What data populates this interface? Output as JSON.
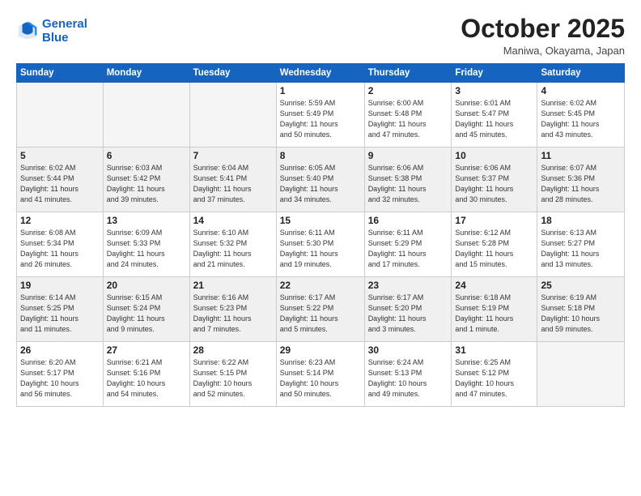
{
  "logo": {
    "line1": "General",
    "line2": "Blue"
  },
  "title": "October 2025",
  "location": "Maniwa, Okayama, Japan",
  "weekdays": [
    "Sunday",
    "Monday",
    "Tuesday",
    "Wednesday",
    "Thursday",
    "Friday",
    "Saturday"
  ],
  "weeks": [
    [
      {
        "day": "",
        "info": ""
      },
      {
        "day": "",
        "info": ""
      },
      {
        "day": "",
        "info": ""
      },
      {
        "day": "1",
        "info": "Sunrise: 5:59 AM\nSunset: 5:49 PM\nDaylight: 11 hours\nand 50 minutes."
      },
      {
        "day": "2",
        "info": "Sunrise: 6:00 AM\nSunset: 5:48 PM\nDaylight: 11 hours\nand 47 minutes."
      },
      {
        "day": "3",
        "info": "Sunrise: 6:01 AM\nSunset: 5:47 PM\nDaylight: 11 hours\nand 45 minutes."
      },
      {
        "day": "4",
        "info": "Sunrise: 6:02 AM\nSunset: 5:45 PM\nDaylight: 11 hours\nand 43 minutes."
      }
    ],
    [
      {
        "day": "5",
        "info": "Sunrise: 6:02 AM\nSunset: 5:44 PM\nDaylight: 11 hours\nand 41 minutes."
      },
      {
        "day": "6",
        "info": "Sunrise: 6:03 AM\nSunset: 5:42 PM\nDaylight: 11 hours\nand 39 minutes."
      },
      {
        "day": "7",
        "info": "Sunrise: 6:04 AM\nSunset: 5:41 PM\nDaylight: 11 hours\nand 37 minutes."
      },
      {
        "day": "8",
        "info": "Sunrise: 6:05 AM\nSunset: 5:40 PM\nDaylight: 11 hours\nand 34 minutes."
      },
      {
        "day": "9",
        "info": "Sunrise: 6:06 AM\nSunset: 5:38 PM\nDaylight: 11 hours\nand 32 minutes."
      },
      {
        "day": "10",
        "info": "Sunrise: 6:06 AM\nSunset: 5:37 PM\nDaylight: 11 hours\nand 30 minutes."
      },
      {
        "day": "11",
        "info": "Sunrise: 6:07 AM\nSunset: 5:36 PM\nDaylight: 11 hours\nand 28 minutes."
      }
    ],
    [
      {
        "day": "12",
        "info": "Sunrise: 6:08 AM\nSunset: 5:34 PM\nDaylight: 11 hours\nand 26 minutes."
      },
      {
        "day": "13",
        "info": "Sunrise: 6:09 AM\nSunset: 5:33 PM\nDaylight: 11 hours\nand 24 minutes."
      },
      {
        "day": "14",
        "info": "Sunrise: 6:10 AM\nSunset: 5:32 PM\nDaylight: 11 hours\nand 21 minutes."
      },
      {
        "day": "15",
        "info": "Sunrise: 6:11 AM\nSunset: 5:30 PM\nDaylight: 11 hours\nand 19 minutes."
      },
      {
        "day": "16",
        "info": "Sunrise: 6:11 AM\nSunset: 5:29 PM\nDaylight: 11 hours\nand 17 minutes."
      },
      {
        "day": "17",
        "info": "Sunrise: 6:12 AM\nSunset: 5:28 PM\nDaylight: 11 hours\nand 15 minutes."
      },
      {
        "day": "18",
        "info": "Sunrise: 6:13 AM\nSunset: 5:27 PM\nDaylight: 11 hours\nand 13 minutes."
      }
    ],
    [
      {
        "day": "19",
        "info": "Sunrise: 6:14 AM\nSunset: 5:25 PM\nDaylight: 11 hours\nand 11 minutes."
      },
      {
        "day": "20",
        "info": "Sunrise: 6:15 AM\nSunset: 5:24 PM\nDaylight: 11 hours\nand 9 minutes."
      },
      {
        "day": "21",
        "info": "Sunrise: 6:16 AM\nSunset: 5:23 PM\nDaylight: 11 hours\nand 7 minutes."
      },
      {
        "day": "22",
        "info": "Sunrise: 6:17 AM\nSunset: 5:22 PM\nDaylight: 11 hours\nand 5 minutes."
      },
      {
        "day": "23",
        "info": "Sunrise: 6:17 AM\nSunset: 5:20 PM\nDaylight: 11 hours\nand 3 minutes."
      },
      {
        "day": "24",
        "info": "Sunrise: 6:18 AM\nSunset: 5:19 PM\nDaylight: 11 hours\nand 1 minute."
      },
      {
        "day": "25",
        "info": "Sunrise: 6:19 AM\nSunset: 5:18 PM\nDaylight: 10 hours\nand 59 minutes."
      }
    ],
    [
      {
        "day": "26",
        "info": "Sunrise: 6:20 AM\nSunset: 5:17 PM\nDaylight: 10 hours\nand 56 minutes."
      },
      {
        "day": "27",
        "info": "Sunrise: 6:21 AM\nSunset: 5:16 PM\nDaylight: 10 hours\nand 54 minutes."
      },
      {
        "day": "28",
        "info": "Sunrise: 6:22 AM\nSunset: 5:15 PM\nDaylight: 10 hours\nand 52 minutes."
      },
      {
        "day": "29",
        "info": "Sunrise: 6:23 AM\nSunset: 5:14 PM\nDaylight: 10 hours\nand 50 minutes."
      },
      {
        "day": "30",
        "info": "Sunrise: 6:24 AM\nSunset: 5:13 PM\nDaylight: 10 hours\nand 49 minutes."
      },
      {
        "day": "31",
        "info": "Sunrise: 6:25 AM\nSunset: 5:12 PM\nDaylight: 10 hours\nand 47 minutes."
      },
      {
        "day": "",
        "info": ""
      }
    ]
  ]
}
